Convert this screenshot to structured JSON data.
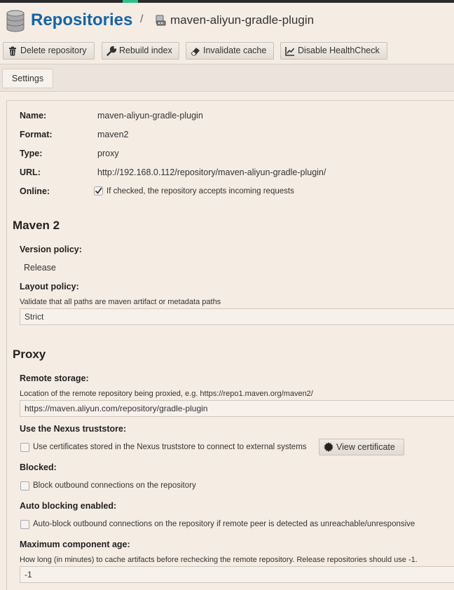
{
  "header": {
    "title": "Repositories",
    "separator": "/",
    "repo_name": "maven-aliyun-gradle-plugin"
  },
  "toolbar": {
    "delete_label": "Delete repository",
    "rebuild_label": "Rebuild index",
    "invalidate_label": "Invalidate cache",
    "healthcheck_label": "Disable HealthCheck"
  },
  "tabs": {
    "settings_label": "Settings"
  },
  "summary": {
    "name_label": "Name:",
    "name_value": "maven-aliyun-gradle-plugin",
    "format_label": "Format:",
    "format_value": "maven2",
    "type_label": "Type:",
    "type_value": "proxy",
    "url_label": "URL:",
    "url_value": "http://192.168.0.112/repository/maven-aliyun-gradle-plugin/",
    "online_label": "Online:",
    "online_checked": true,
    "online_text": "If checked, the repository accepts incoming requests"
  },
  "maven2": {
    "section_title": "Maven 2",
    "version_policy_label": "Version policy:",
    "version_policy_value": "Release",
    "layout_policy_label": "Layout policy:",
    "layout_policy_help": "Validate that all paths are maven artifact or metadata paths",
    "layout_policy_value": "Strict"
  },
  "proxy": {
    "section_title": "Proxy",
    "remote_storage_label": "Remote storage:",
    "remote_storage_help": "Location of the remote repository being proxied, e.g. https://repo1.maven.org/maven2/",
    "remote_storage_value": "https://maven.aliyun.com/repository/gradle-plugin",
    "truststore_label": "Use the Nexus truststore:",
    "truststore_text": "Use certificates stored in the Nexus truststore to connect to external systems",
    "view_certificate_label": "View certificate",
    "blocked_label": "Blocked:",
    "blocked_text": "Block outbound connections on the repository",
    "auto_blocking_label": "Auto blocking enabled:",
    "auto_blocking_text": "Auto-block outbound connections on the repository if remote peer is detected as unreachable/unresponsive",
    "max_age_label": "Maximum component age:",
    "max_age_help": "How long (in minutes) to cache artifacts before rechecking the remote repository. Release repositories should use -1.",
    "max_age_value": "-1"
  },
  "colors": {
    "accent": "#1565a5",
    "background": "#f5ece3",
    "topbar": "#2b2b2b",
    "topbar_tab": "#2fbf8a"
  },
  "icons": {
    "title": "database-icon",
    "repo": "repository-icon",
    "delete": "trash-icon",
    "rebuild": "wrench-icon",
    "invalidate": "eraser-icon",
    "healthcheck": "chart-line-icon",
    "certificate": "certificate-icon"
  }
}
